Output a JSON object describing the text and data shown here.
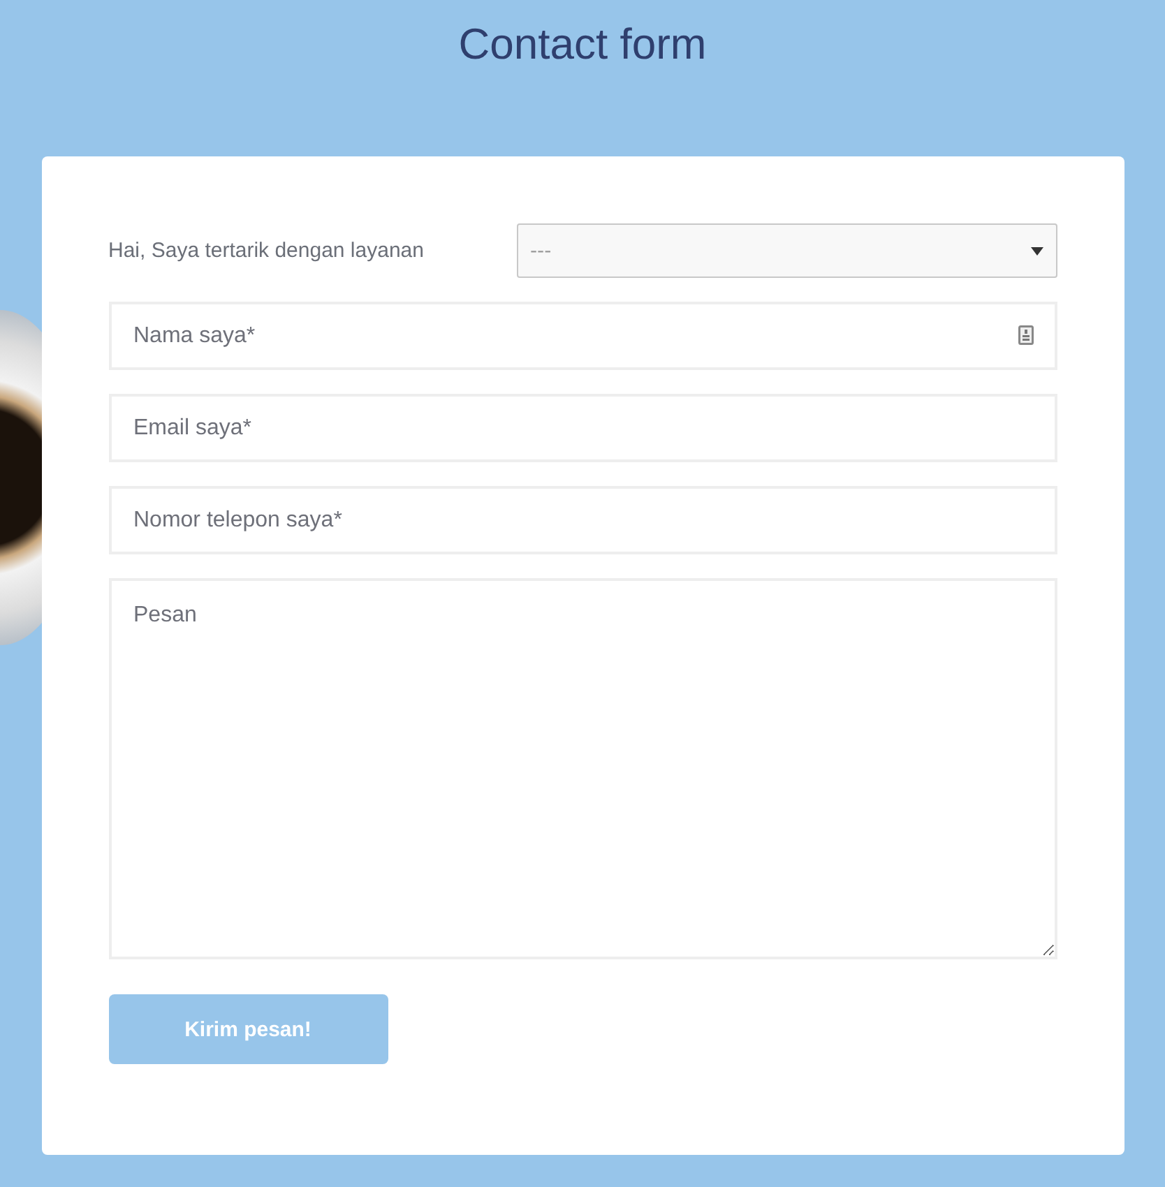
{
  "title": "Contact form",
  "service": {
    "label": "Hai, Saya tertarik dengan layanan",
    "value": "---"
  },
  "fields": [
    {
      "kind": "input",
      "placeholder": "Nama saya*",
      "icon": true
    },
    {
      "kind": "input",
      "placeholder": "Email saya*",
      "icon": false
    },
    {
      "kind": "input",
      "placeholder": "Nomor telepon saya*",
      "icon": false
    },
    {
      "kind": "textarea",
      "placeholder": "Pesan"
    }
  ],
  "submit": {
    "label": "Kirim pesan!"
  }
}
